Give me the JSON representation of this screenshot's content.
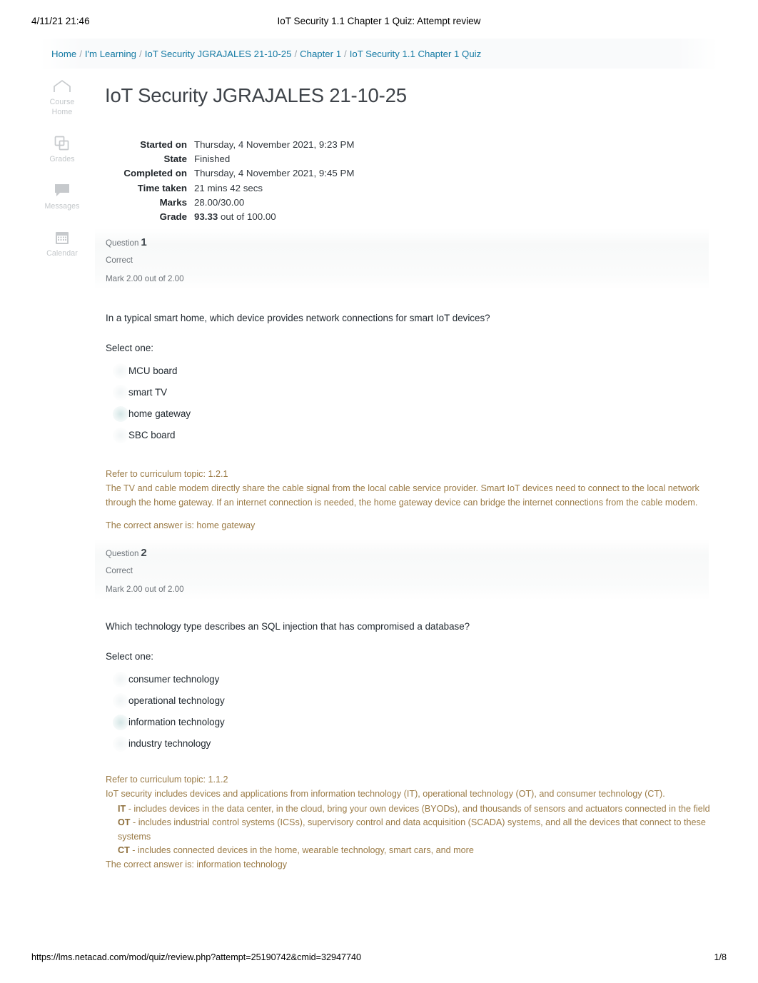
{
  "print_header": {
    "date": "4/11/21 21:46",
    "title": "IoT Security 1.1 Chapter 1 Quiz: Attempt review"
  },
  "breadcrumb": {
    "separator": "/",
    "items": [
      {
        "label": "Home"
      },
      {
        "label": "I'm Learning"
      },
      {
        "label": "IoT Security JGRAJALES 21-10-25"
      },
      {
        "label": "Chapter 1"
      },
      {
        "label": "IoT Security 1.1 Chapter 1 Quiz"
      }
    ]
  },
  "sidebar": {
    "items": [
      {
        "icon": "home-icon",
        "label": "Course",
        "label2": "Home"
      },
      {
        "icon": "grades-icon",
        "label": "Grades",
        "label2": ""
      },
      {
        "icon": "messages-icon",
        "label": "Messages",
        "label2": ""
      },
      {
        "icon": "calendar-icon",
        "label": "Calendar",
        "label2": ""
      }
    ]
  },
  "page_title": "IoT Security JGRAJALES 21-10-25",
  "summary": [
    {
      "key": "Started on",
      "value": "Thursday, 4 November 2021, 9:23 PM"
    },
    {
      "key": "State",
      "value": "Finished"
    },
    {
      "key": "Completed on",
      "value": "Thursday, 4 November 2021, 9:45 PM"
    },
    {
      "key": "Time taken",
      "value": "21 mins 42 secs"
    },
    {
      "key": "Marks",
      "value": "28.00/30.00"
    },
    {
      "key": "Grade",
      "value_bold": "93.33",
      "value": " out of 100.00"
    }
  ],
  "questions": [
    {
      "number_label": "Question",
      "number": "1",
      "state": "Correct",
      "mark": "Mark 2.00 out of 2.00",
      "text": "In a typical smart home, which device provides network connections for smart IoT devices?",
      "select_label": "Select one:",
      "options": [
        {
          "label": "MCU board",
          "selected": false,
          "correct": false
        },
        {
          "label": "smart TV",
          "selected": false,
          "correct": false
        },
        {
          "label": "home gateway",
          "selected": true,
          "correct": true
        },
        {
          "label": "SBC board",
          "selected": false,
          "correct": false
        }
      ],
      "feedback": {
        "topic": "Refer to curriculum topic: 1.2.1",
        "paragraph": "The TV and cable modem directly share the cable signal from the local cable service provider. Smart IoT devices need to connect to the local network through the home gateway. If an internet connection is needed, the home gateway device can bridge the internet connections from the cable modem.",
        "bullets": [],
        "answer": "The correct answer is: home gateway"
      }
    },
    {
      "number_label": "Question",
      "number": "2",
      "state": "Correct",
      "mark": "Mark 2.00 out of 2.00",
      "text": "Which technology type describes an SQL injection that has compromised a database?",
      "select_label": "Select one:",
      "options": [
        {
          "label": "consumer technology",
          "selected": false,
          "correct": false
        },
        {
          "label": "operational technology",
          "selected": false,
          "correct": false
        },
        {
          "label": "information technology",
          "selected": true,
          "correct": true
        },
        {
          "label": "industry technology",
          "selected": false,
          "correct": false
        }
      ],
      "feedback": {
        "topic": "Refer to curriculum topic: 1.1.2",
        "paragraph": "IoT security includes devices and applications from information technology (IT), operational technology (OT), and consumer technology (CT).",
        "bullets": [
          {
            "term": "IT",
            "text": " - includes devices in the data center, in the cloud, bring your own devices (BYODs), and thousands of sensors and actuators connected in the field"
          },
          {
            "term": "OT",
            "text": " - includes industrial control systems (ICSs), supervisory control and data acquisition (SCADA) systems, and all the devices that connect to these systems"
          },
          {
            "term": "CT",
            "text": " - includes connected devices in the home, wearable technology, smart cars, and more"
          }
        ],
        "answer": "The correct answer is: information technology"
      }
    }
  ],
  "footer": {
    "url": "https://lms.netacad.com/mod/quiz/review.php?attempt=25190742&cmid=32947740",
    "page": "1/8"
  },
  "colors": {
    "link": "#1379a3",
    "feedback": "#9b7b46",
    "correct_tick": "#3d7a2b",
    "heading": "#3e4349"
  }
}
